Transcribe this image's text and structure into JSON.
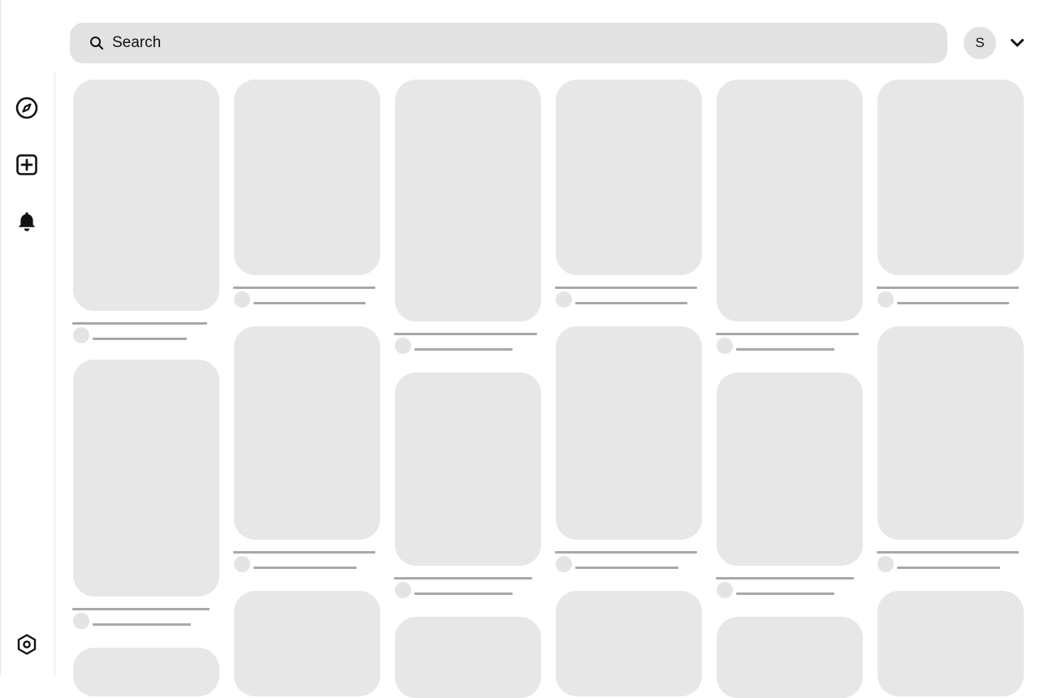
{
  "sidebar": {
    "items": [
      {
        "name": "explore",
        "icon": "compass-icon"
      },
      {
        "name": "create",
        "icon": "plus-square-icon"
      },
      {
        "name": "notifications",
        "icon": "bell-icon"
      }
    ],
    "footer": {
      "name": "settings",
      "icon": "settings-hexagon-icon"
    }
  },
  "header": {
    "search": {
      "placeholder": "Search",
      "icon": "search-icon"
    },
    "account": {
      "initial": "S",
      "menu_icon": "chevron-down-icon"
    }
  },
  "feed": {
    "state": "loading-placeholders",
    "columns": 6,
    "placeholder_color": "#e7e7e7",
    "line_color": "#a8a8a8"
  }
}
